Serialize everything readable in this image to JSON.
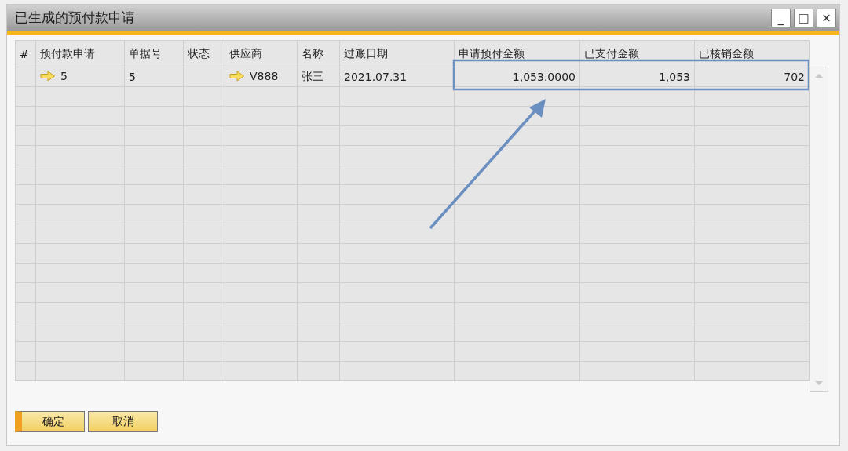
{
  "window": {
    "title": "已生成的预付款申请",
    "controls": [
      "_",
      "□",
      "×"
    ]
  },
  "table": {
    "columns": [
      "#",
      "预付款申请",
      "单据号",
      "状态",
      "供应商",
      "名称",
      "过账日期",
      "申请预付金额",
      "已支付金额",
      "已核销金额"
    ],
    "rows": [
      {
        "cells": [
          {
            "text": "",
            "linked": false
          },
          {
            "text": "5",
            "linked": true
          },
          {
            "text": "5",
            "linked": false
          },
          {
            "text": "",
            "linked": false
          },
          {
            "text": "V888",
            "linked": true
          },
          {
            "text": "张三",
            "linked": false
          },
          {
            "text": "2021.07.31",
            "linked": false
          },
          {
            "text": "1,053.0000",
            "linked": false
          },
          {
            "text": "1,053",
            "linked": false
          },
          {
            "text": "702",
            "linked": false
          }
        ]
      }
    ]
  },
  "buttons": [
    {
      "label": "确定",
      "selected": true
    },
    {
      "label": "取消",
      "selected": false
    }
  ]
}
